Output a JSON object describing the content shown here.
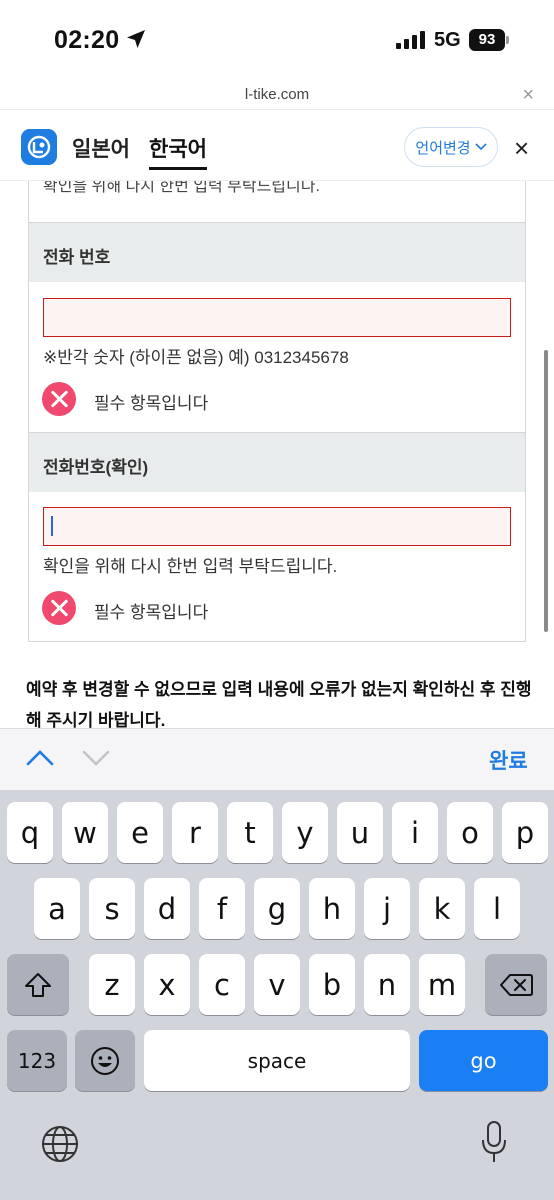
{
  "status_bar": {
    "time": "02:20",
    "network": "5G",
    "battery": "93"
  },
  "url_bar": {
    "url": "l-tike.com",
    "close": "×"
  },
  "header": {
    "tabs": [
      {
        "label": "일본어",
        "active": false
      },
      {
        "label": "한국어",
        "active": true
      }
    ],
    "lang_button": "언어변경",
    "close": "×"
  },
  "form": {
    "clipped_text": "확인을 위해 다시 한번 입력 부탁드립니다.",
    "phone": {
      "label": "전화 번호",
      "value": "",
      "hint": "※반각 숫자 (하이픈 없음) 예) 0312345678",
      "error": "필수 항목입니다"
    },
    "phone_confirm": {
      "label": "전화번호(확인)",
      "value": "",
      "hint": "확인을 위해 다시 한번 입력 부탁드립니다.",
      "error": "필수 항목입니다"
    }
  },
  "notice": "예약 후 변경할 수 없으므로 입력 내용에 오류가 없는지 확인하신 후 진행해 주시기 바랍니다.",
  "accessory": {
    "done": "완료"
  },
  "keyboard": {
    "row1": [
      "q",
      "w",
      "e",
      "r",
      "t",
      "y",
      "u",
      "i",
      "o",
      "p"
    ],
    "row2": [
      "a",
      "s",
      "d",
      "f",
      "g",
      "h",
      "j",
      "k",
      "l"
    ],
    "row3": [
      "z",
      "x",
      "c",
      "v",
      "b",
      "n",
      "m"
    ],
    "numbers": "123",
    "space": "space",
    "go": "go"
  },
  "colors": {
    "accent": "#1f7de0",
    "error": "#cc1b1b",
    "error_icon": "#f0486e",
    "go_key": "#1a7ef5"
  }
}
